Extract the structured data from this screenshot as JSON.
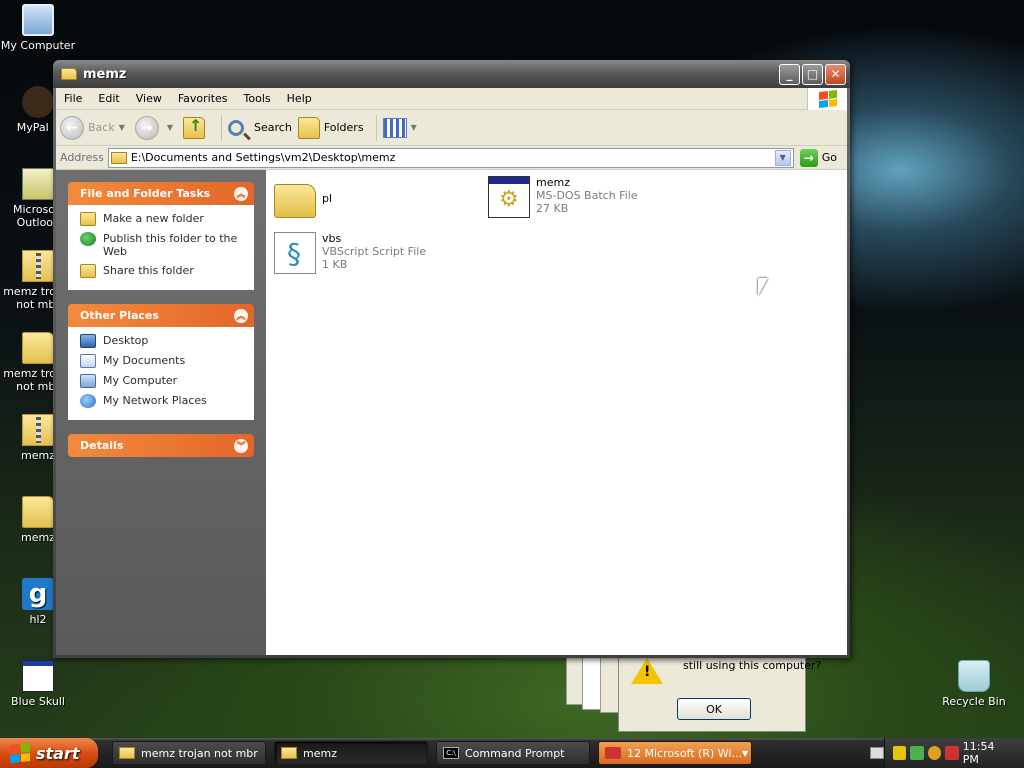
{
  "desktop": {
    "icons": [
      {
        "label": "My Computer",
        "icon": "computer-icon"
      },
      {
        "label": "MyPal 6",
        "icon": "mypal-icon"
      },
      {
        "label": "Microsoft Outlook",
        "icon": "outlook-icon"
      },
      {
        "label": "memz trojan not mbr",
        "icon": "zip-icon"
      },
      {
        "label": "memz trojan not mbr",
        "icon": "folder-icon"
      },
      {
        "label": "memz",
        "icon": "zip-icon"
      },
      {
        "label": "memz",
        "icon": "folder-icon"
      },
      {
        "label": "hl2",
        "icon": "hl2-icon"
      },
      {
        "label": "Blue Skull",
        "icon": "blue-skull-icon"
      },
      {
        "label": "Recycle Bin",
        "icon": "recycle-bin-icon"
      }
    ]
  },
  "window": {
    "title": "memz",
    "menu": [
      "File",
      "Edit",
      "View",
      "Favorites",
      "Tools",
      "Help"
    ],
    "toolbar": {
      "back": "Back",
      "search": "Search",
      "folders": "Folders"
    },
    "address": {
      "label": "Address",
      "value": "E:\\Documents and Settings\\vm2\\Desktop\\memz",
      "go": "Go"
    },
    "tasks": {
      "file_folder_title": "File and Folder Tasks",
      "file_folder_items": [
        "Make a new folder",
        "Publish this folder to the Web",
        "Share this folder"
      ],
      "other_places_title": "Other Places",
      "other_places_items": [
        "Desktop",
        "My Documents",
        "My Computer",
        "My Network Places"
      ],
      "details_title": "Details"
    },
    "files": [
      {
        "name": "pl",
        "type": "",
        "size": "",
        "icon": "folder-icon"
      },
      {
        "name": "memz",
        "type": "MS-DOS Batch File",
        "size": "27 KB",
        "icon": "batch-file-icon"
      },
      {
        "name": "vbs",
        "type": "VBScript Script File",
        "size": "1 KB",
        "icon": "vbscript-icon"
      }
    ]
  },
  "message_box": {
    "text": "still using this computer?",
    "ok": "OK"
  },
  "taskbar": {
    "start": "start",
    "tasks": [
      {
        "label": "memz trojan not mbr",
        "icon": "folder-icon"
      },
      {
        "label": "memz",
        "icon": "folder-icon"
      },
      {
        "label": "Command Prompt",
        "icon": "cmd-icon"
      },
      {
        "label": "12 Microsoft (R) Wi...",
        "icon": "app-icon"
      }
    ],
    "clock": "11:54 PM"
  }
}
